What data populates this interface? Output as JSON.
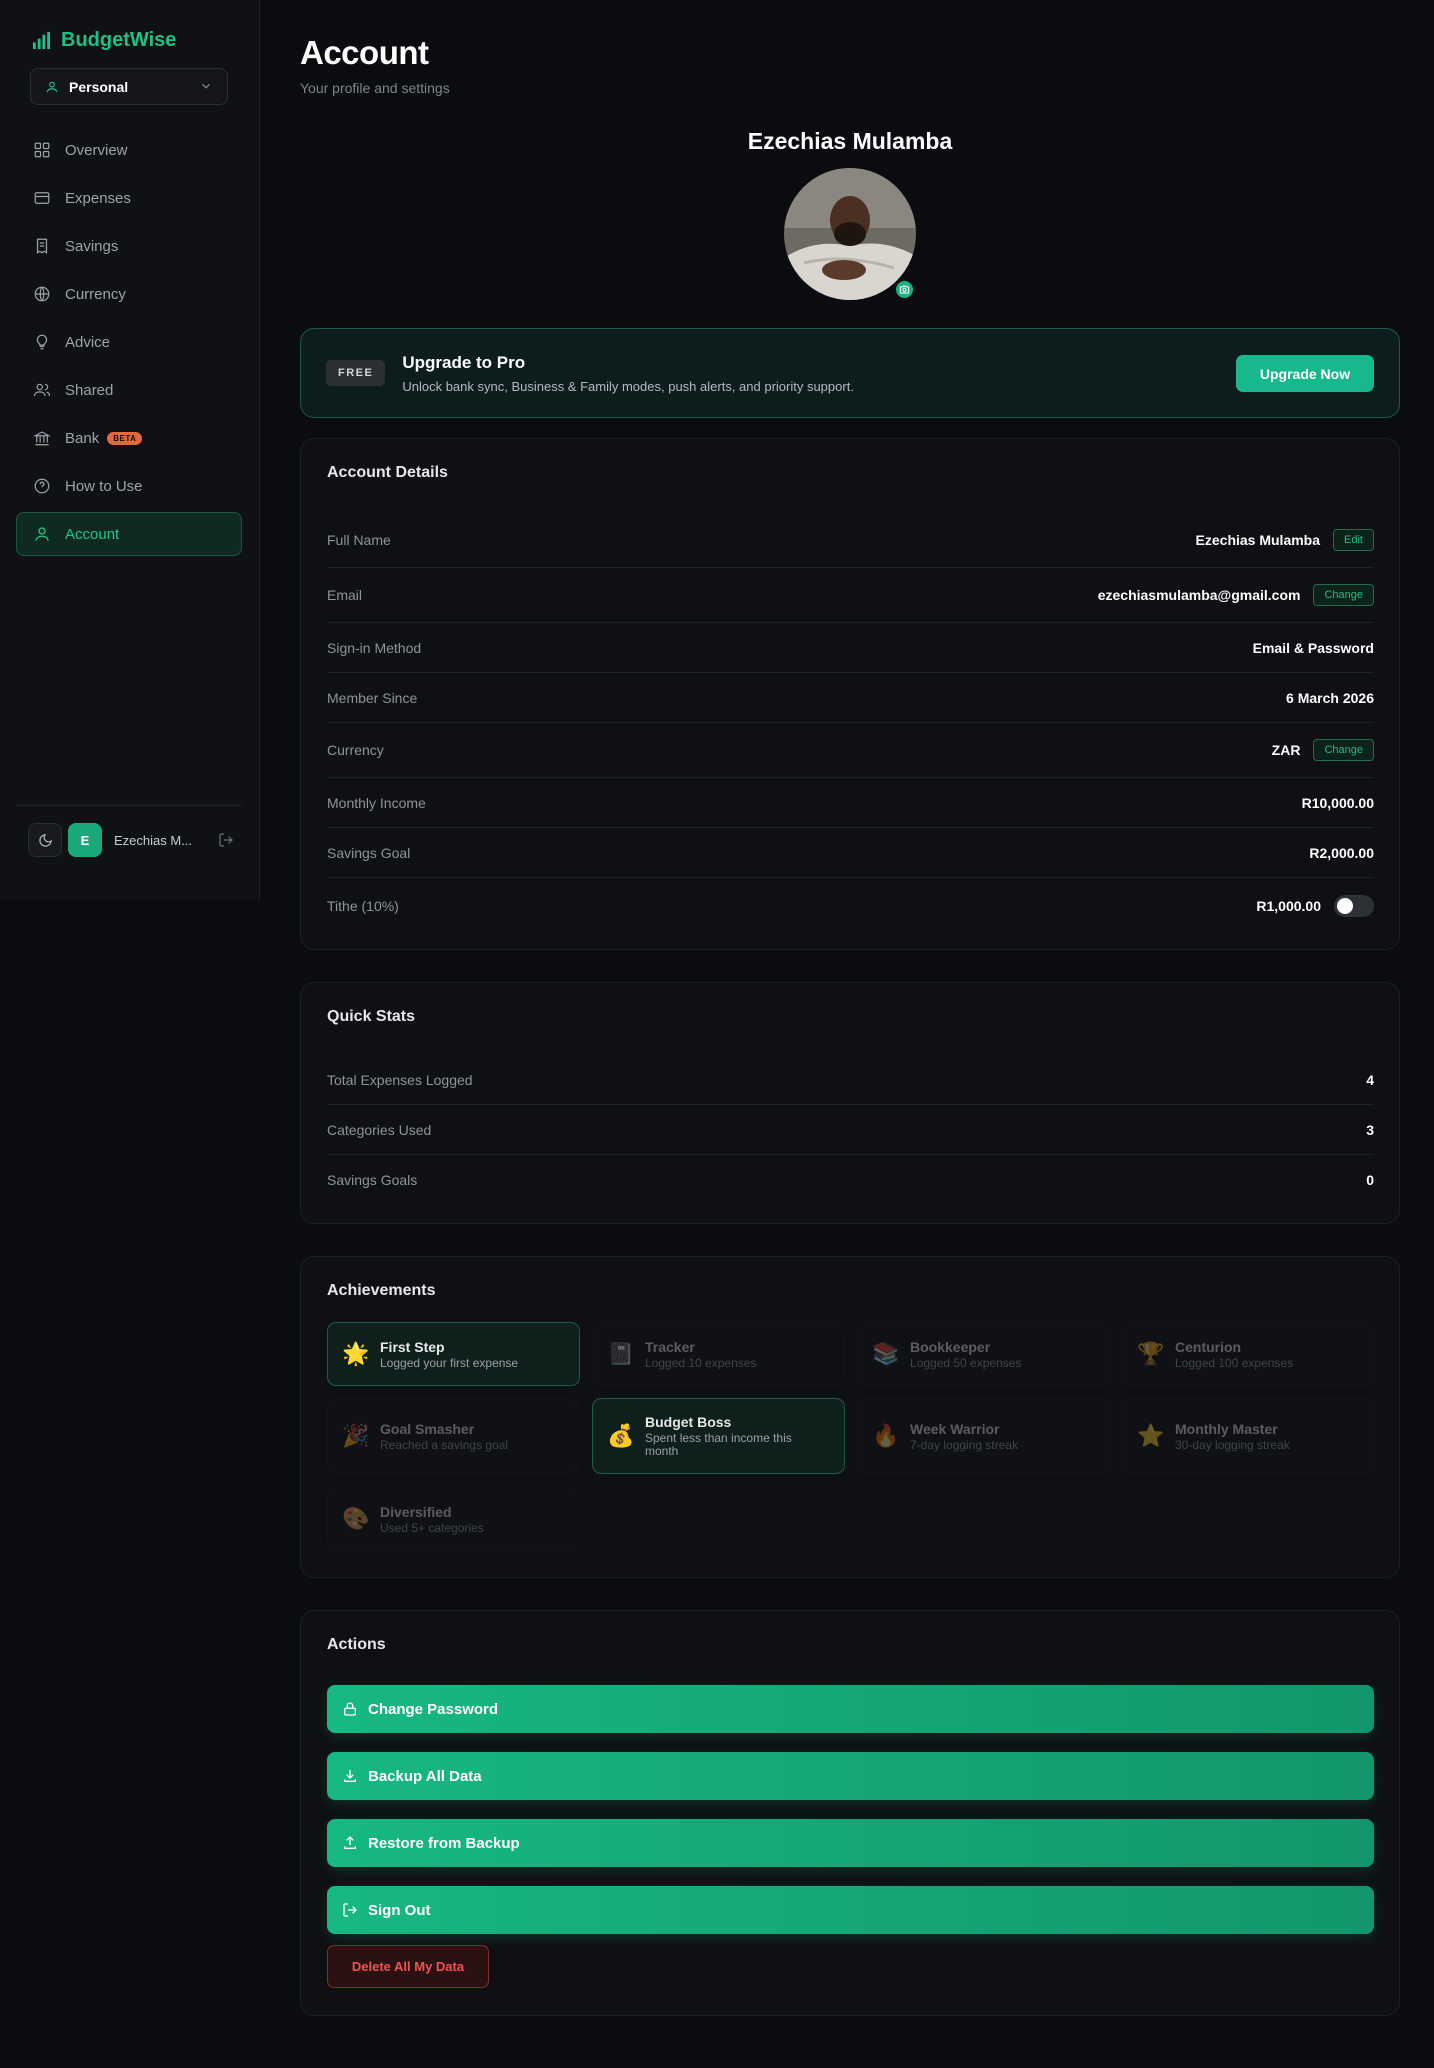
{
  "app": {
    "name": "BudgetWise",
    "brand_color": "#1fbf86"
  },
  "mode": {
    "label": "Personal"
  },
  "nav": [
    {
      "label": "Overview",
      "icon": "grid-icon"
    },
    {
      "label": "Expenses",
      "icon": "card-icon"
    },
    {
      "label": "Savings",
      "icon": "receipt-icon"
    },
    {
      "label": "Currency",
      "icon": "globe-icon"
    },
    {
      "label": "Advice",
      "icon": "lightbulb-icon"
    },
    {
      "label": "Shared",
      "icon": "users-icon"
    },
    {
      "label": "Bank",
      "icon": "bank-icon",
      "badge": "BETA"
    },
    {
      "label": "How to Use",
      "icon": "help-icon"
    },
    {
      "label": "Account",
      "icon": "user-icon",
      "active": true
    }
  ],
  "sidebar_footer": {
    "avatar_initial": "E",
    "user_name": "Ezechias M..."
  },
  "page": {
    "title": "Account",
    "subtitle": "Your profile and settings",
    "profile_name": "Ezechias Mulamba"
  },
  "upgrade": {
    "badge": "FREE",
    "title": "Upgrade to Pro",
    "description": "Unlock bank sync, Business & Family modes, push alerts, and priority support.",
    "button": "Upgrade Now"
  },
  "account_details": {
    "title": "Account Details",
    "rows": [
      {
        "label": "Full Name",
        "value": "Ezechias Mulamba",
        "action": "Edit"
      },
      {
        "label": "Email",
        "value": "ezechiasmulamba@gmail.com",
        "action": "Change"
      },
      {
        "label": "Sign-in Method",
        "value": "Email & Password"
      },
      {
        "label": "Member Since",
        "value": "6 March 2026"
      },
      {
        "label": "Currency",
        "value": "ZAR",
        "action": "Change"
      },
      {
        "label": "Monthly Income",
        "value": "R10,000.00"
      },
      {
        "label": "Savings Goal",
        "value": "R2,000.00"
      },
      {
        "label": "Tithe (10%)",
        "value": "R1,000.00",
        "toggle": false
      }
    ]
  },
  "quick_stats": {
    "title": "Quick Stats",
    "rows": [
      {
        "label": "Total Expenses Logged",
        "value": "4"
      },
      {
        "label": "Categories Used",
        "value": "3"
      },
      {
        "label": "Savings Goals",
        "value": "0"
      }
    ]
  },
  "achievements": {
    "title": "Achievements",
    "items": [
      {
        "emoji": "🌟",
        "title": "First Step",
        "desc": "Logged your first expense",
        "unlocked": true
      },
      {
        "emoji": "📓",
        "title": "Tracker",
        "desc": "Logged 10 expenses",
        "unlocked": false
      },
      {
        "emoji": "📚",
        "title": "Bookkeeper",
        "desc": "Logged 50 expenses",
        "unlocked": false
      },
      {
        "emoji": "🏆",
        "title": "Centurion",
        "desc": "Logged 100 expenses",
        "unlocked": false
      },
      {
        "emoji": "🎉",
        "title": "Goal Smasher",
        "desc": "Reached a savings goal",
        "unlocked": false
      },
      {
        "emoji": "💰",
        "title": "Budget Boss",
        "desc": "Spent less than income this month",
        "unlocked": true
      },
      {
        "emoji": "🔥",
        "title": "Week Warrior",
        "desc": "7-day logging streak",
        "unlocked": false
      },
      {
        "emoji": "⭐",
        "title": "Monthly Master",
        "desc": "30-day logging streak",
        "unlocked": false
      },
      {
        "emoji": "🎨",
        "title": "Diversified",
        "desc": "Used 5+ categories",
        "unlocked": false
      }
    ]
  },
  "actions": {
    "title": "Actions",
    "buttons": [
      {
        "label": "Change Password",
        "icon": "lock-icon"
      },
      {
        "label": "Backup All Data",
        "icon": "download-icon"
      },
      {
        "label": "Restore from Backup",
        "icon": "upload-icon"
      },
      {
        "label": "Sign Out",
        "icon": "sign-out-icon"
      }
    ],
    "delete_label": "Delete All My Data"
  }
}
